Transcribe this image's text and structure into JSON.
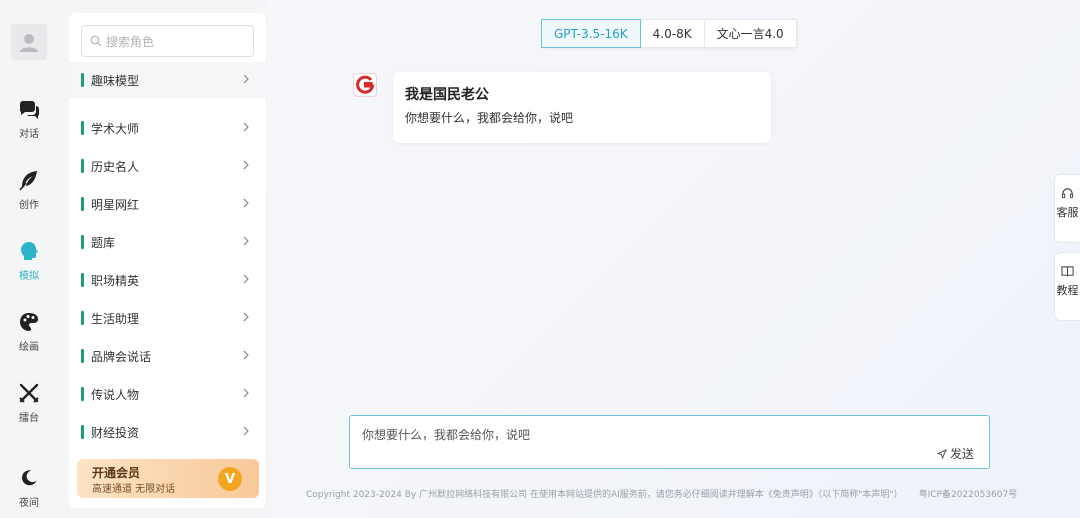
{
  "rail": {
    "items": [
      {
        "label": "对话",
        "icon": "chat-icon"
      },
      {
        "label": "创作",
        "icon": "feather-icon"
      },
      {
        "label": "模拟",
        "icon": "head-icon"
      },
      {
        "label": "绘画",
        "icon": "palette-icon"
      },
      {
        "label": "擂台",
        "icon": "swords-icon"
      },
      {
        "label": "夜间",
        "icon": "moon-icon"
      }
    ],
    "active": "模拟"
  },
  "panel": {
    "search_placeholder": "搜索角色",
    "categories": [
      "趣味模型",
      "学术大师",
      "历史名人",
      "明星网红",
      "题库",
      "职场精英",
      "生活助理",
      "品牌会说话",
      "传说人物",
      "财经投资"
    ],
    "vip": {
      "title": "开通会员",
      "subtitle": "高速通道 无限对话",
      "badge": "V"
    }
  },
  "models": {
    "tabs": [
      "GPT-3.5-16K",
      "4.0-8K",
      "文心一言4.0"
    ],
    "active": "GPT-3.5-16K"
  },
  "chat": {
    "bot_title": "我是国民老公",
    "bot_message": "你想要什么，我都会给你，说吧"
  },
  "side": {
    "service": "客服",
    "tutorial": "教程"
  },
  "composer": {
    "placeholder": "你想要什么，我都会给你，说吧",
    "send_label": "发送"
  },
  "footer": {
    "copyright": "Copyright 2023-2024 By 广州默拉网络科技有限公司 在使用本网站提供的AI服务前，请您务必仔细阅读并理解本《免责声明》（以下简称\"本声明\"）",
    "icp": "粤ICP备2022053607号"
  },
  "colors": {
    "accent": "#2cb3c7",
    "category_bar": "#1aa06d",
    "vip_gold": "#f2a51f"
  }
}
